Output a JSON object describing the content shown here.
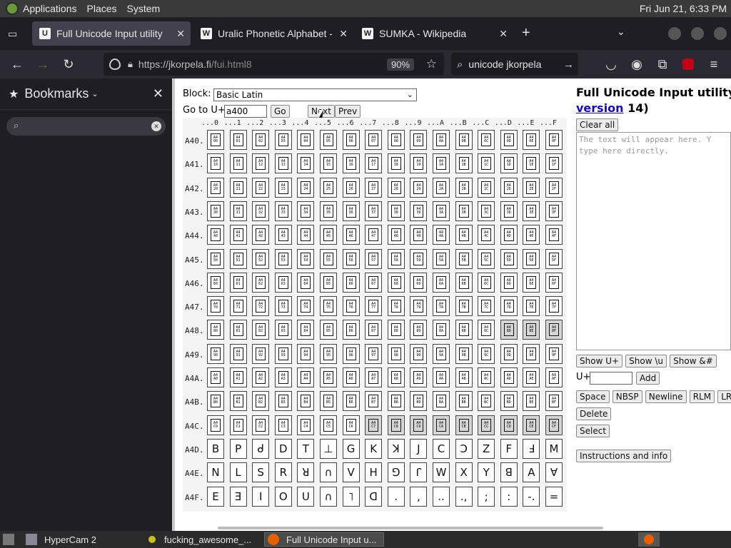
{
  "topbar": {
    "menus": [
      "Applications",
      "Places",
      "System"
    ],
    "clock": "Fri Jun 21,  6:33 PM"
  },
  "tabs": [
    {
      "title": "Full Unicode Input utility",
      "favicon": "U",
      "active": true
    },
    {
      "title": "Uralic Phonetic Alphabet - W",
      "favicon": "W",
      "active": false
    },
    {
      "title": "SUMKA - Wikipedia",
      "favicon": "W",
      "active": false
    }
  ],
  "nav": {
    "url_host": "https://jkorpela.fi",
    "url_path": "/fui.html8",
    "zoom": "90%",
    "search_text": "unicode jkorpela"
  },
  "sidebar": {
    "title": "Bookmarks",
    "search_value": ""
  },
  "page": {
    "block_label": "Block:",
    "block_selected": "Basic Latin",
    "goto_label": "Go to U+",
    "goto_value": "a400",
    "go_btn": "Go",
    "next_btn": "Next",
    "prev_btn": "Prev",
    "title_line1": "Full Unicode Input utility (f",
    "title_link": "version",
    "title_suffix": " 14)",
    "clear_all": "Clear all",
    "textarea_placeholder": "The text will appear here. Y type here directly.",
    "show_buttons": [
      "Show U+",
      "Show \\u",
      "Show &#"
    ],
    "uplus_label": "U+",
    "add_btn": "Add",
    "insert_buttons_row1": [
      "Space",
      "NBSP",
      "Newline",
      "RLM",
      "LRM"
    ],
    "delete_btn": "Delete",
    "select_btn": "Select",
    "instructions_btn": "Instructions and info"
  },
  "grid": {
    "col_headers": [
      "...0",
      "...1",
      "...2",
      "...3",
      "...4",
      "...5",
      "...6",
      "...7",
      "...8",
      "...9",
      "...A",
      "...B",
      "...C",
      "...D",
      "...E",
      "...F"
    ],
    "row_labels": [
      "A40.",
      "A41.",
      "A42.",
      "A43.",
      "A44.",
      "A45.",
      "A46.",
      "A47.",
      "A48.",
      "A49.",
      "A4A.",
      "A4B.",
      "A4C.",
      "A4D.",
      "A4E.",
      "A4F."
    ],
    "row_prefixes": [
      "A40",
      "A41",
      "A42",
      "A43",
      "A44",
      "A45",
      "A46",
      "A47",
      "A48",
      "A49",
      "A4A",
      "A4B",
      "A4C",
      "A4D",
      "A4E",
      "A4F"
    ],
    "hex_digits": [
      "0",
      "1",
      "2",
      "3",
      "4",
      "5",
      "6",
      "7",
      "8",
      "9",
      "A",
      "B",
      "C",
      "D",
      "E",
      "F"
    ],
    "glyph_rows": {
      "A4D": [
        "B",
        "P",
        "ᑯ",
        "D",
        "T",
        "⊥",
        "G",
        "K",
        "ꓘ",
        "J",
        "C",
        "Ɔ",
        "Z",
        "F",
        "Ⅎ",
        "M"
      ],
      "A4E": [
        "N",
        "L",
        "S",
        "R",
        "ꓤ",
        "∩",
        "V",
        "H",
        "⅁",
        "ꓩ",
        "W",
        "X",
        "Y",
        "ꓭ",
        "A",
        "∀"
      ],
      "A4F": [
        "E",
        "Ǝ",
        "I",
        "O",
        "U",
        "∩",
        "˥",
        "ꓷ",
        ".",
        ",",
        "..",
        ".,",
        ";",
        ":",
        "-.",
        "="
      ]
    },
    "gray_cells": [
      "A48D",
      "A48E",
      "A48F",
      "A4C7",
      "A4C8",
      "A4C9",
      "A4CA",
      "A4CB",
      "A4CC",
      "A4CD",
      "A4CE",
      "A4CF"
    ]
  },
  "taskbar": {
    "items": [
      "HyperCam 2",
      "fucking_awesome_...",
      "Full Unicode Input u..."
    ]
  },
  "colors": {
    "ublock": "#c00018"
  }
}
